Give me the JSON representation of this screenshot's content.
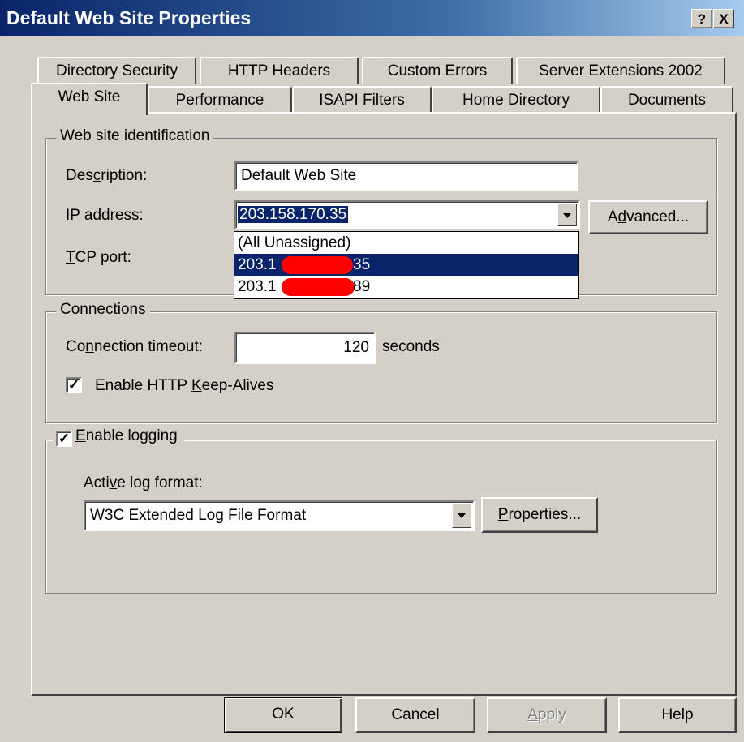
{
  "window": {
    "title": "Default Web Site Properties",
    "help_button": "?",
    "close_button": "X"
  },
  "tabs": {
    "row1": [
      "Directory Security",
      "HTTP Headers",
      "Custom Errors",
      "Server Extensions 2002"
    ],
    "row2": [
      "Web Site",
      "Performance",
      "ISAPI Filters",
      "Home Directory",
      "Documents"
    ],
    "active": "Web Site"
  },
  "identification": {
    "legend": "Web site identification",
    "description_label": "Description:",
    "description_value": "Default Web Site",
    "ip_label": "IP address:",
    "ip_value": "203.158.170.35",
    "advanced_button": "Advanced...",
    "tcp_label": "TCP port:",
    "ip_options": [
      "(All Unassigned)",
      "203.1",
      "35",
      "203.1",
      "89"
    ]
  },
  "connections": {
    "legend": "Connections",
    "timeout_label": "Connection timeout:",
    "timeout_value": "120",
    "timeout_unit": "seconds",
    "keepalive_label": "Enable HTTP Keep-Alives",
    "keepalive_checked": true
  },
  "logging": {
    "legend": "Enable logging",
    "enabled": true,
    "format_label": "Active log format:",
    "format_value": "W3C Extended Log File Format",
    "properties_button": "Properties..."
  },
  "footer": {
    "ok": "OK",
    "cancel": "Cancel",
    "apply": "Apply",
    "help": "Help"
  }
}
